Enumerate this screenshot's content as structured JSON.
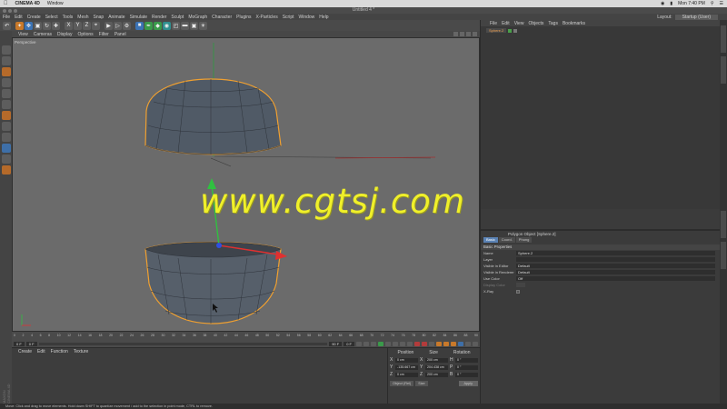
{
  "mac_menu": {
    "app_name": "CINEMA 4D",
    "window_menu": "Window",
    "clock": "Mon 7:40 PM"
  },
  "window": {
    "title": "Untitled 4 *"
  },
  "menu_bar": {
    "items": [
      "File",
      "Edit",
      "Create",
      "Select",
      "Tools",
      "Mesh",
      "Snap",
      "Animate",
      "Simulate",
      "Render",
      "Sculpt",
      "MoGraph",
      "Character",
      "Plugins",
      "X-Particles",
      "Script",
      "Window",
      "Help"
    ],
    "layout_label": "Layout:",
    "layout_value": "Startup (User)"
  },
  "viewport": {
    "menu": [
      "View",
      "Cameras",
      "Display",
      "Options",
      "Filter",
      "Panel"
    ],
    "label": "Perspective",
    "watermark": "www.cgtsj.com"
  },
  "timeline": {
    "ticks": [
      "0",
      "2",
      "4",
      "6",
      "8",
      "10",
      "12",
      "14",
      "16",
      "18",
      "20",
      "22",
      "24",
      "26",
      "28",
      "30",
      "32",
      "34",
      "36",
      "38",
      "40",
      "42",
      "44",
      "46",
      "48",
      "50",
      "52",
      "54",
      "56",
      "58",
      "60",
      "62",
      "64",
      "66",
      "68",
      "70",
      "72",
      "74",
      "76",
      "78",
      "80",
      "82",
      "84",
      "86",
      "88",
      "90"
    ],
    "current_frame": "0 F",
    "start_field": "0 F",
    "end_field": "90 F",
    "frame_readout": "0 F"
  },
  "material_manager": {
    "menu": [
      "Create",
      "Edit",
      "Function",
      "Texture"
    ]
  },
  "coordinates": {
    "headers": [
      "Position",
      "Size",
      "Rotation"
    ],
    "rows": [
      {
        "axis": "X",
        "pos": "0 cm",
        "size": "200 cm",
        "rot_label": "H",
        "rot": "0 °"
      },
      {
        "axis": "Y",
        "pos": "-135.667 cm",
        "size": "204.438 cm",
        "rot_label": "P",
        "rot": "0 °"
      },
      {
        "axis": "Z",
        "pos": "0 cm",
        "size": "200 cm",
        "rot_label": "B",
        "rot": "0 °"
      }
    ],
    "mode_select": "Object (Rel)",
    "size_select": "Size",
    "apply_label": "Apply"
  },
  "object_manager": {
    "menu": [
      "File",
      "Edit",
      "View",
      "Objects",
      "Tags",
      "Bookmarks"
    ],
    "object_name": "Sphere.2"
  },
  "attributes": {
    "title": "Polygon Object [Sphere.2]",
    "tabs": [
      "Basic",
      "Coord.",
      "Phong"
    ],
    "section": "Basic Properties",
    "rows": [
      {
        "label": "Name",
        "value": "Sphere.2"
      },
      {
        "label": "Layer",
        "value": ""
      },
      {
        "label": "Visible in Editor",
        "value": "Default"
      },
      {
        "label": "Visible in Renderer",
        "value": "Default"
      },
      {
        "label": "Use Color",
        "value": "Off"
      },
      {
        "label": "Display Color",
        "value": ""
      },
      {
        "label": "X-Ray",
        "value": ""
      }
    ]
  },
  "status_bar": {
    "text": "Move: Click and drag to move elements. Hold down SHIFT to quantize movement / add to the selection in point mode, CTRL to remove."
  },
  "brand": {
    "side_label": "MAXON CINEMA 4D"
  },
  "colors": {
    "selection_outline": "#f0a030",
    "watermark": "#f0f02a",
    "axis_x": "#e03030",
    "axis_y": "#30c040",
    "axis_z": "#3050e0"
  }
}
